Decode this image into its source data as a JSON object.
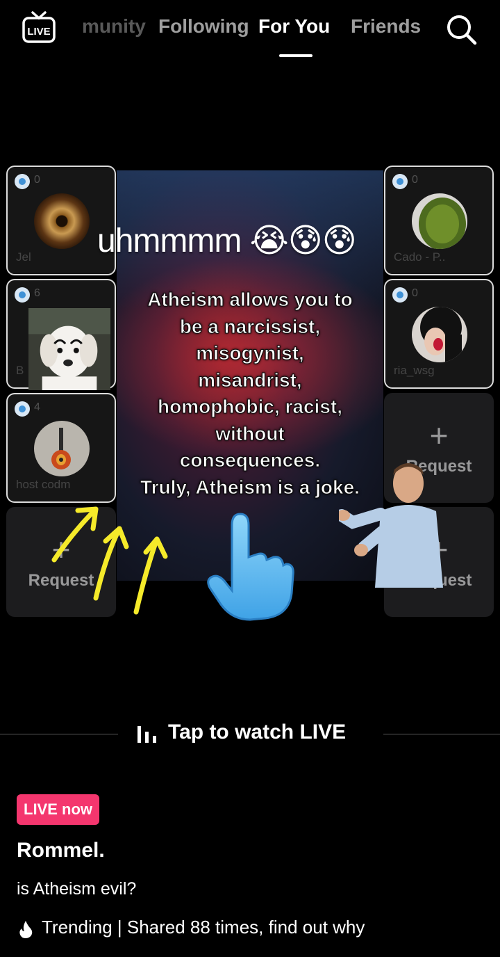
{
  "nav": {
    "live_icon_label": "LIVE",
    "tabs": [
      {
        "label": "munity",
        "active": false
      },
      {
        "label": "Following",
        "active": false
      },
      {
        "label": "For You",
        "active": true
      },
      {
        "label": "Friends",
        "active": false
      }
    ],
    "search_icon": "search-icon"
  },
  "guest_tiles": {
    "left": [
      {
        "name": "Jel",
        "count": "0",
        "occupied": true
      },
      {
        "name": "B",
        "count": "6",
        "occupied": true
      },
      {
        "name": "host codm",
        "count": "4",
        "occupied": true
      },
      {
        "name": "",
        "request_label": "Request",
        "occupied": false
      }
    ],
    "right": [
      {
        "name": "Cado - P..",
        "count": "0",
        "occupied": true
      },
      {
        "name": "ria_wsg",
        "count": "0",
        "occupied": true
      },
      {
        "name": "",
        "request_label": "Request",
        "occupied": false
      },
      {
        "name": "",
        "request_label": "Request",
        "occupied": false
      }
    ]
  },
  "video": {
    "caption_top": "uhmmmm 😭😰😰",
    "meme_text": "Atheism allows you to\nbe a narcissist,\nmisogynist,\nmisandrist,\nhomophobic, racist,\nwithout\nconsequences.\nTruly, Atheism is a joke."
  },
  "tap_to_watch": {
    "label": "Tap to watch LIVE",
    "icon": "bars-icon"
  },
  "info": {
    "live_badge": "LIVE now",
    "host_name": "Rommel.",
    "title": "is Atheism evil?",
    "trending_text": "Trending | Shared 88 times, find out why",
    "trending_icon": "fire-icon"
  },
  "colors": {
    "background": "#000000",
    "live_badge": "#f4366e",
    "arrows": "#f5ea2a",
    "hand": "#6ec3f5",
    "verified_badge": "#3f91d6"
  }
}
